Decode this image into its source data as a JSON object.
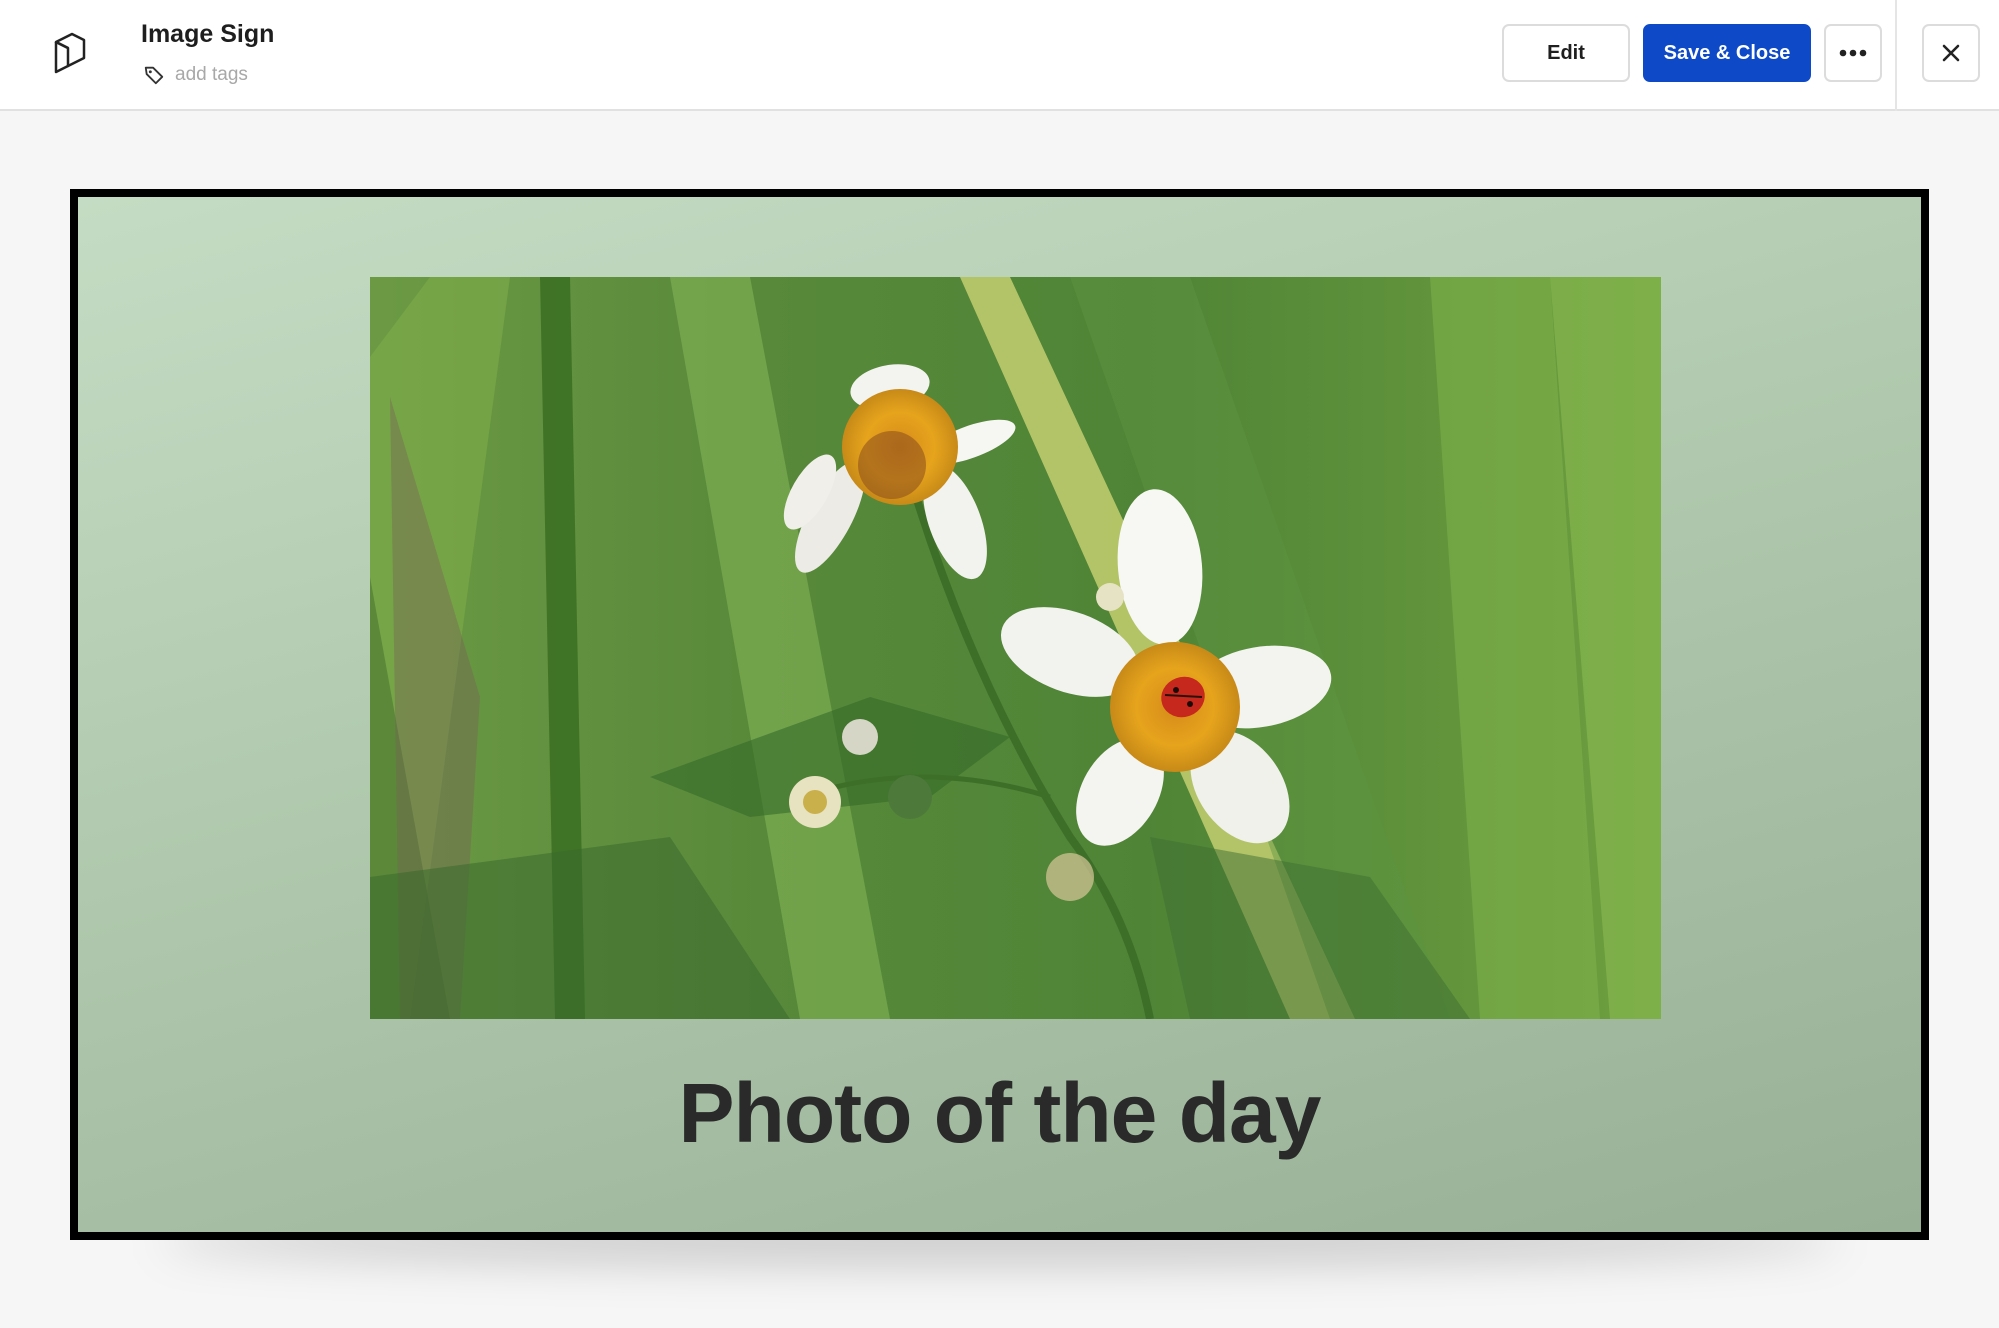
{
  "header": {
    "logo_icon": "cube-logo-icon",
    "title": "Image Sign",
    "tags_placeholder": "add tags",
    "tag_icon": "tag-icon"
  },
  "toolbar": {
    "edit_label": "Edit",
    "save_label": "Save & Close",
    "more_icon": "more-horizontal-icon",
    "close_icon": "close-icon",
    "accent_color": "#0e4ac7"
  },
  "sign": {
    "caption": "Photo of the day",
    "photo_subject": "white flowers with ladybug in green grass",
    "border_color": "#000000",
    "background_color": "#b0c9ae"
  }
}
